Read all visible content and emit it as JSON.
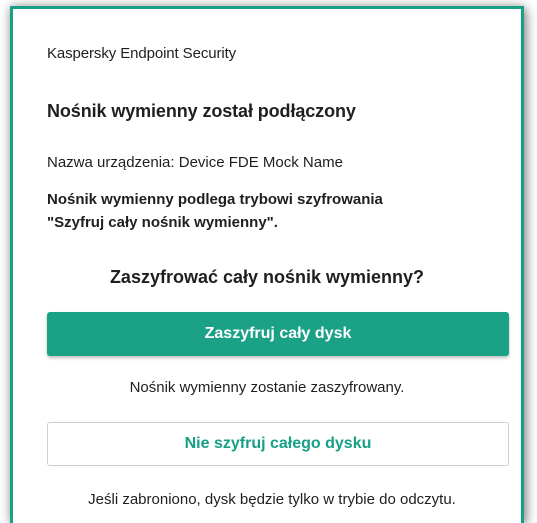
{
  "app": {
    "title": "Kaspersky Endpoint Security"
  },
  "dialog": {
    "heading": "Nośnik wymienny został podłączony",
    "device_label": "Nazwa urządzenia: Device FDE Mock Name",
    "policy_line_1": "Nośnik wymienny podlega trybowi szyfrowania",
    "policy_line_2": "\"Szyfruj cały nośnik wymienny\".",
    "question": "Zaszyfrować cały nośnik wymienny?"
  },
  "actions": {
    "encrypt_label": "Zaszyfruj cały dysk",
    "encrypt_note": "Nośnik wymienny zostanie zaszyfrowany.",
    "skip_label": "Nie szyfruj całego dysku",
    "skip_note": "Jeśli zabroniono, dysk będzie tylko w trybie do odczytu."
  },
  "colors": {
    "accent": "#1ba185",
    "border": "#16a085",
    "text": "#1f1f1f"
  }
}
